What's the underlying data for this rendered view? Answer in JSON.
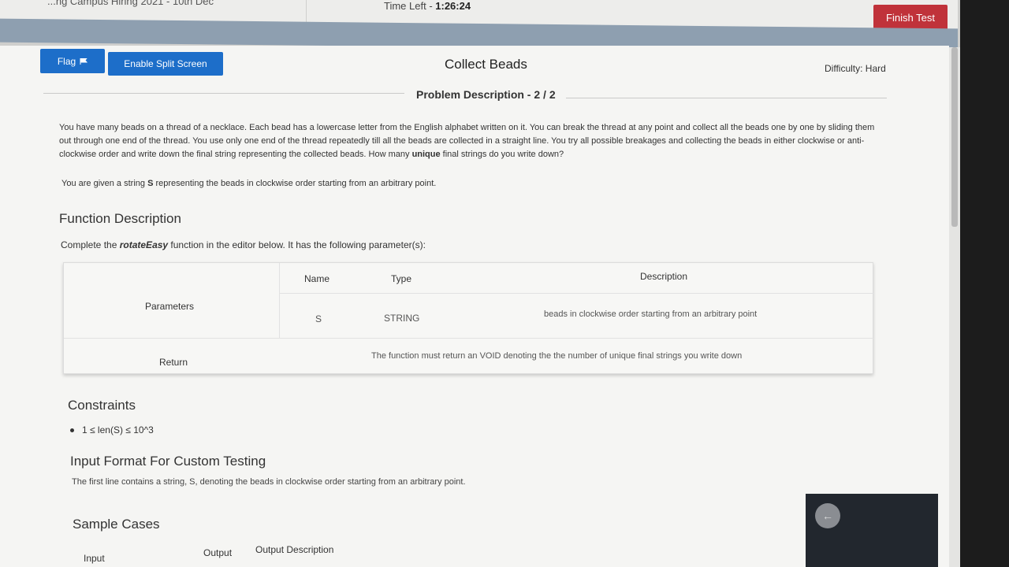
{
  "header": {
    "test_title": "...ng Campus Hiring 2021 - 10th Dec",
    "time_left_label": "Time Left - ",
    "time_left_value": "1:26:24",
    "finish_button": "Finish Test"
  },
  "toolbar": {
    "flag_button": "Flag",
    "split_screen_button": "Enable Split Screen"
  },
  "problem": {
    "title": "Collect Beads",
    "difficulty": "Difficulty: Hard",
    "section_heading": "Problem Description - 2 / 2",
    "description_part1": "You have many beads on a thread of a necklace. Each bead has a lowercase letter from the English alphabet written on it. You can break the thread at any point and collect all the beads one by one by sliding them out through one end of the thread. You use only one end of the thread repeatedly till all the beads are collected in a straight line. You try all possible breakages and collecting the beads in either clockwise or anti-clockwise order and write down the final string representing the collected beads. How many ",
    "description_bold": "unique",
    "description_part2": " final strings do you write down?",
    "given_prefix": "You are given a string ",
    "given_var": "S",
    "given_suffix": " representing the beads in clockwise order starting from an arbitrary point."
  },
  "function_description": {
    "heading": "Function Description",
    "sub_prefix": "Complete the ",
    "function_name": "rotateEasy",
    "sub_suffix": " function in the editor below. It has the following parameter(s):",
    "table": {
      "col_name": "Name",
      "col_type": "Type",
      "col_description": "Description",
      "row_parameters_label": "Parameters",
      "param_name": "S",
      "param_type": "STRING",
      "param_description": "beads in clockwise order starting from an arbitrary point",
      "row_return_label": "Return",
      "return_description": "The function must return an VOID denoting the the number of unique final strings you write down"
    }
  },
  "constraints": {
    "heading": "Constraints",
    "items": [
      "1 ≤ len(S) ≤ 10^3"
    ]
  },
  "input_format": {
    "heading": "Input Format For Custom Testing",
    "text": "The first line contains a string, S, denoting the beads in clockwise order starting from an arbitrary point."
  },
  "sample_cases": {
    "heading": "Sample Cases",
    "col_input": "Input",
    "col_output": "Output",
    "col_output_description": "Output Description"
  },
  "icons": {
    "flag": "flag-icon",
    "back": "arrow-left-icon"
  },
  "colors": {
    "primary_button": "#1d6ec9",
    "finish_button": "#c0323a"
  }
}
